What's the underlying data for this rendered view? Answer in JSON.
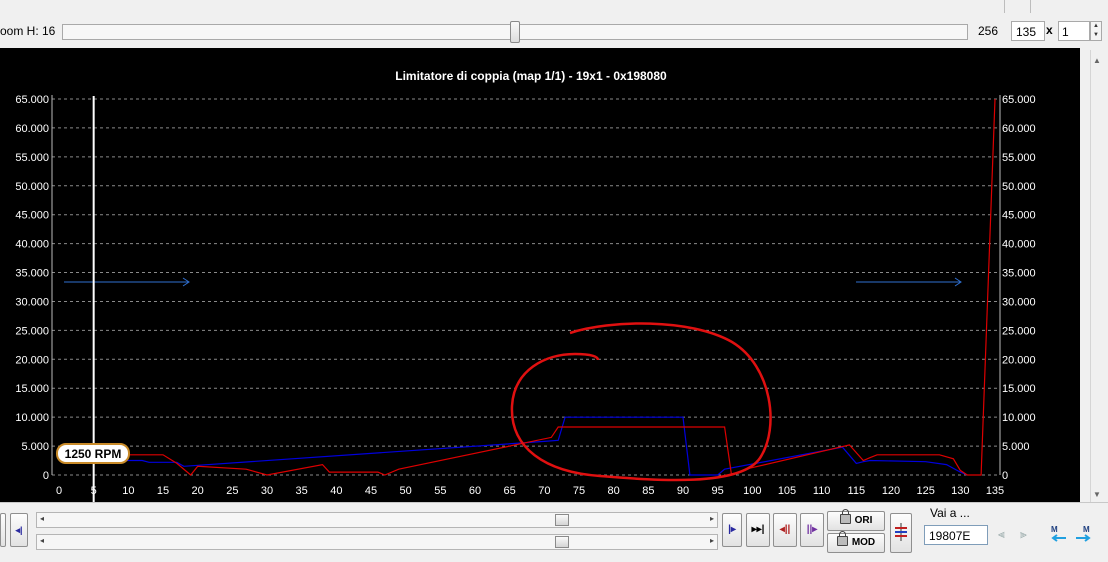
{
  "zoom": {
    "label": "oom H: 16",
    "max": "256",
    "value": "135",
    "x_symbol": "x",
    "multiplier": "1",
    "slider_position": 0.5
  },
  "chart_data": {
    "type": "line",
    "title": "Limitatore di coppia (map 1/1) - 19x1 - 0x198080",
    "xlim": [
      0,
      135
    ],
    "ylim": [
      0,
      65000
    ],
    "x_ticks": [
      "0",
      "5",
      "10",
      "15",
      "20",
      "25",
      "30",
      "35",
      "40",
      "45",
      "50",
      "55",
      "60",
      "65",
      "70",
      "75",
      "80",
      "85",
      "90",
      "95",
      "100",
      "105",
      "110",
      "115",
      "120",
      "125",
      "130",
      "135"
    ],
    "y_ticks": [
      "0",
      "5.000",
      "10.000",
      "15.000",
      "20.000",
      "25.000",
      "30.000",
      "35.000",
      "40.000",
      "45.000",
      "50.000",
      "55.000",
      "60.000",
      "65.000"
    ],
    "grid": true,
    "cursor": {
      "x": 5,
      "label": "1250 RPM"
    },
    "series": [
      {
        "color": "#0000dd",
        "points": [
          [
            0,
            2500
          ],
          [
            12,
            2500
          ],
          [
            13,
            2200
          ],
          [
            17,
            2200
          ],
          [
            18,
            1500
          ],
          [
            70,
            5800
          ],
          [
            72,
            6000
          ],
          [
            73,
            10000
          ],
          [
            90,
            10000
          ],
          [
            91,
            0
          ],
          [
            95,
            0
          ],
          [
            96,
            1000
          ],
          [
            113,
            4800
          ],
          [
            115,
            2000
          ],
          [
            116,
            2300
          ],
          [
            117,
            2500
          ],
          [
            125,
            2300
          ],
          [
            128,
            1800
          ],
          [
            130,
            500
          ],
          [
            131,
            0
          ]
        ]
      },
      {
        "color": "#dd0000",
        "points": [
          [
            0,
            3500
          ],
          [
            15,
            3500
          ],
          [
            17,
            2000
          ],
          [
            19,
            0
          ],
          [
            20,
            1500
          ],
          [
            27,
            1000
          ],
          [
            30,
            0
          ],
          [
            38,
            1800
          ],
          [
            39,
            500
          ],
          [
            46,
            500
          ],
          [
            47,
            0
          ],
          [
            49,
            1000
          ],
          [
            71,
            6500
          ],
          [
            72,
            8300
          ],
          [
            96,
            8300
          ],
          [
            97,
            0
          ],
          [
            99,
            1000
          ],
          [
            114,
            5200
          ],
          [
            116,
            2500
          ],
          [
            117,
            3000
          ],
          [
            118,
            3500
          ],
          [
            127,
            3500
          ],
          [
            129,
            2800
          ],
          [
            130,
            800
          ],
          [
            131,
            0
          ],
          [
            133,
            0
          ],
          [
            135,
            65000
          ]
        ]
      }
    ]
  },
  "toolbar": {
    "ori_label": "ORI",
    "mod_label": "MOD",
    "goto_label": "Vai a ...",
    "address": "19807E"
  }
}
